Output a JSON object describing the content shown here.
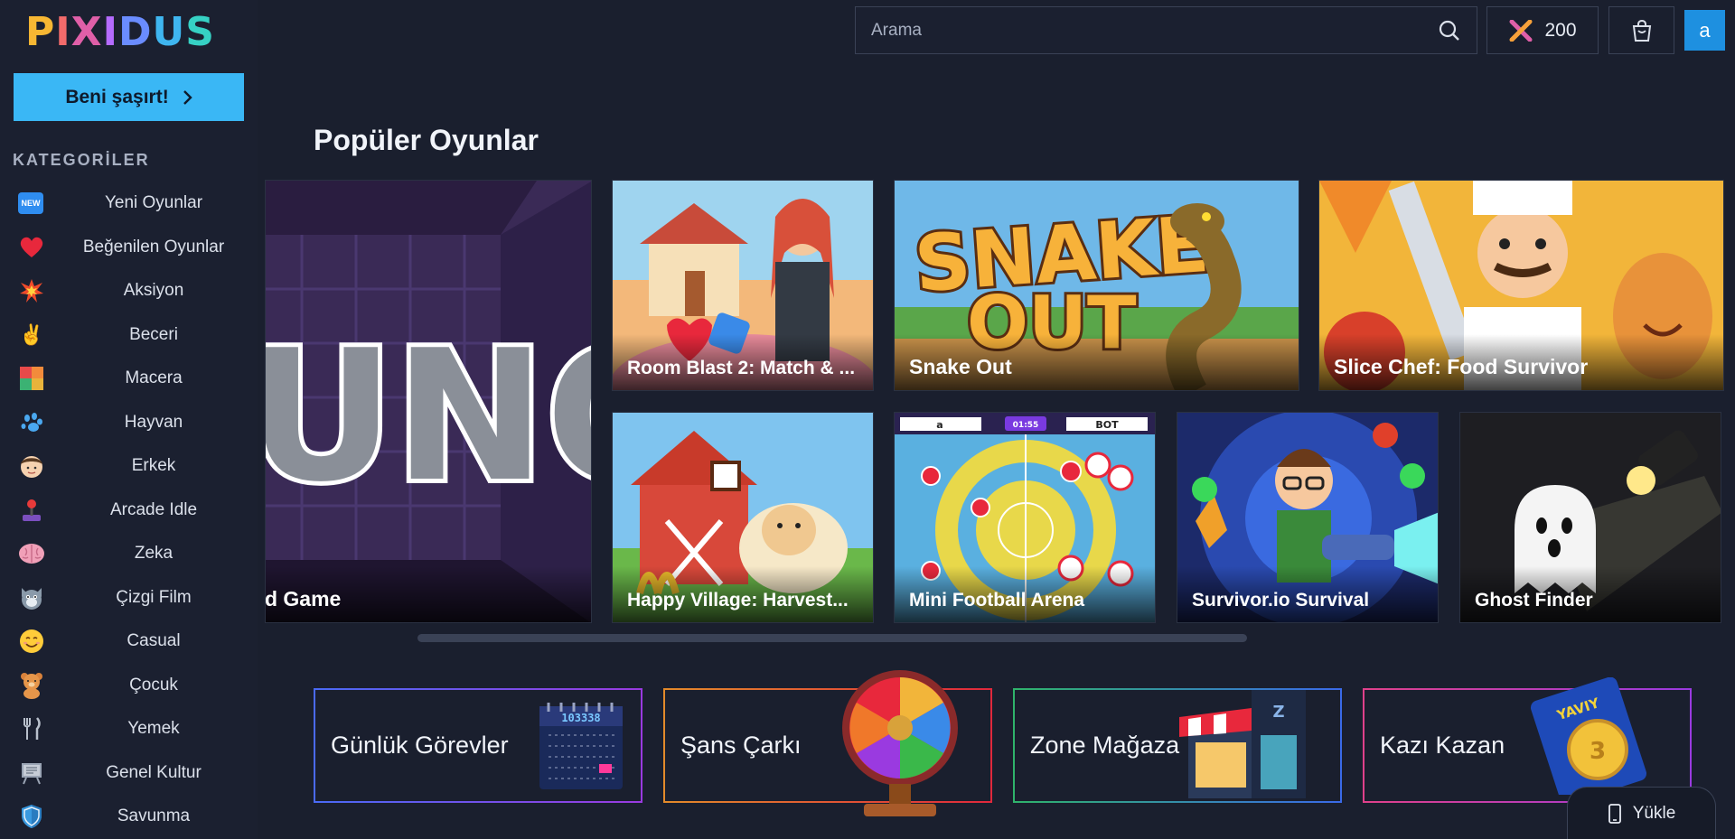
{
  "brand": {
    "logo_letters": [
      "P",
      "I",
      "X",
      "I",
      "D",
      "U",
      "S"
    ]
  },
  "sidebar": {
    "surprise_label": "Beni şaşırt!",
    "categories_title": "KATEGORİLER",
    "items": [
      {
        "label": "Yeni Oyunlar",
        "icon": "new-icon"
      },
      {
        "label": "Beğenilen Oyunlar",
        "icon": "heart-icon"
      },
      {
        "label": "Aksiyon",
        "icon": "explosion-icon"
      },
      {
        "label": "Beceri",
        "icon": "victory-hand-icon"
      },
      {
        "label": "Macera",
        "icon": "puzzle-icon"
      },
      {
        "label": "Hayvan",
        "icon": "paw-icon"
      },
      {
        "label": "Erkek",
        "icon": "boy-icon"
      },
      {
        "label": "Arcade Idle",
        "icon": "joystick-icon"
      },
      {
        "label": "Zeka",
        "icon": "brain-icon"
      },
      {
        "label": "Çizgi Film",
        "icon": "cat-icon"
      },
      {
        "label": "Casual",
        "icon": "smile-icon"
      },
      {
        "label": "Çocuk",
        "icon": "teddy-bear-icon"
      },
      {
        "label": "Yemek",
        "icon": "fork-knife-icon"
      },
      {
        "label": "Genel Kultur",
        "icon": "board-icon"
      },
      {
        "label": "Savunma",
        "icon": "shield-icon"
      }
    ]
  },
  "header": {
    "search_placeholder": "Arama",
    "coins": "200",
    "avatar_letter": "a"
  },
  "main": {
    "section_title": "Popüler Oyunlar",
    "games": [
      {
        "title": "rd Game",
        "theme": "uno"
      },
      {
        "title": "Room Blast 2: Match & ...",
        "theme": "room"
      },
      {
        "title": "Snake Out",
        "theme": "snake"
      },
      {
        "title": "Slice Chef: Food Survivor",
        "theme": "chef"
      },
      {
        "title": "Happy Village: Harvest...",
        "theme": "village"
      },
      {
        "title": "Mini Football Arena",
        "theme": "football"
      },
      {
        "title": "Survivor.io Survival",
        "theme": "survivor"
      },
      {
        "title": "Ghost Finder",
        "theme": "ghost"
      }
    ],
    "features": [
      {
        "label": "Günlük Görevler",
        "border": "#5b5bf5"
      },
      {
        "label": "Şans Çarkı",
        "border": "#e36b2a"
      },
      {
        "label": "Zone Mağaza",
        "border": "#2fb36b"
      },
      {
        "label": "Kazı Kazan",
        "border": "#c944c9"
      }
    ],
    "install_label": "Yükle"
  },
  "colors": {
    "accent": "#3ab7f5",
    "bg": "#1a1f2e",
    "avatar": "#1e90e0"
  }
}
